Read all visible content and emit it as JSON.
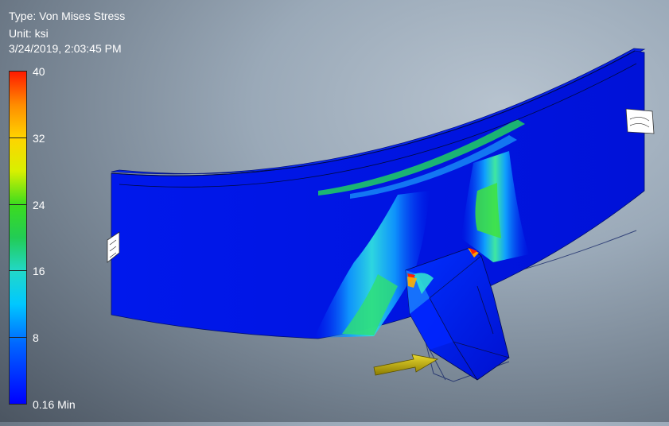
{
  "result_info": {
    "type_text": "Type: Von Mises Stress",
    "unit_text": "Unit: ksi",
    "timestamp": "3/24/2019, 2:03:45 PM"
  },
  "legend": {
    "ticks": [
      {
        "label": "40",
        "value": 40
      },
      {
        "label": "32",
        "value": 32
      },
      {
        "label": "24",
        "value": 24
      },
      {
        "label": "16",
        "value": 16
      },
      {
        "label": "8",
        "value": 8
      },
      {
        "label": "0.16 Min",
        "value": 0.16
      }
    ],
    "colors": [
      "#ff1a00",
      "#ff8c00",
      "#ffd400",
      "#3cdc1e",
      "#22d8c8",
      "#00c8ff",
      "#0000ff"
    ]
  },
  "model": {
    "beam_color": "#0014e6",
    "hotspot_color": "#ff2200",
    "load_arrow_color": "#c8b400"
  }
}
